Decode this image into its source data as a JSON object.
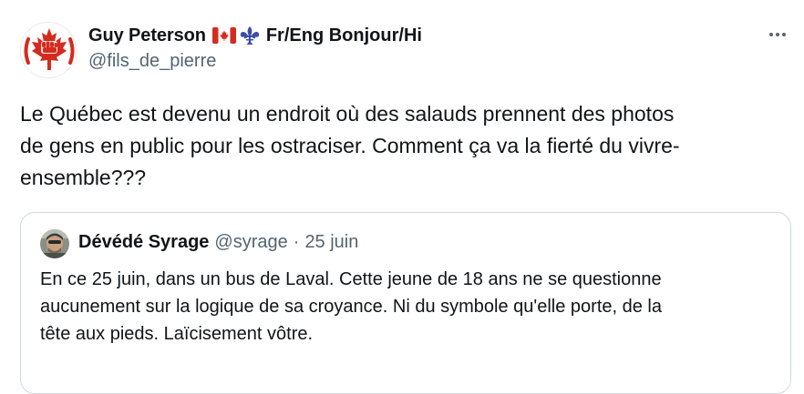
{
  "author": {
    "display_name": "Guy Peterson",
    "name_suffix": "Fr/Eng Bonjour/Hi",
    "handle": "@fils_de_pierre",
    "avatar_icon": "raised-fist-maple-leaf-icon",
    "flag_icon": "canada-flag-icon",
    "fleur_icon": "fleur-de-lis-icon"
  },
  "more_icon": "more-options-icon",
  "tweet_text": "Le Québec est devenu un endroit où des salauds prennent des photos\nde gens en public pour les ostraciser. Comment ça va la fierté du vivre-\nensemble???",
  "quote": {
    "display_name": "Dévédé Syrage",
    "handle": "@syrage",
    "separator": "·",
    "date": "25 juin",
    "text": "En ce 25 juin, dans un bus de Laval. Cette jeune de 18 ans ne se questionne\naucunement sur la logique de sa croyance. Ni du symbole qu'elle porte, de la\ntête aux pieds. Laïcisement vôtre."
  },
  "colors": {
    "text": "#0f1419",
    "secondary": "#536471",
    "border": "#cfd9de",
    "canada_red": "#d52b1e",
    "quebec_blue": "#3b4fa8"
  }
}
